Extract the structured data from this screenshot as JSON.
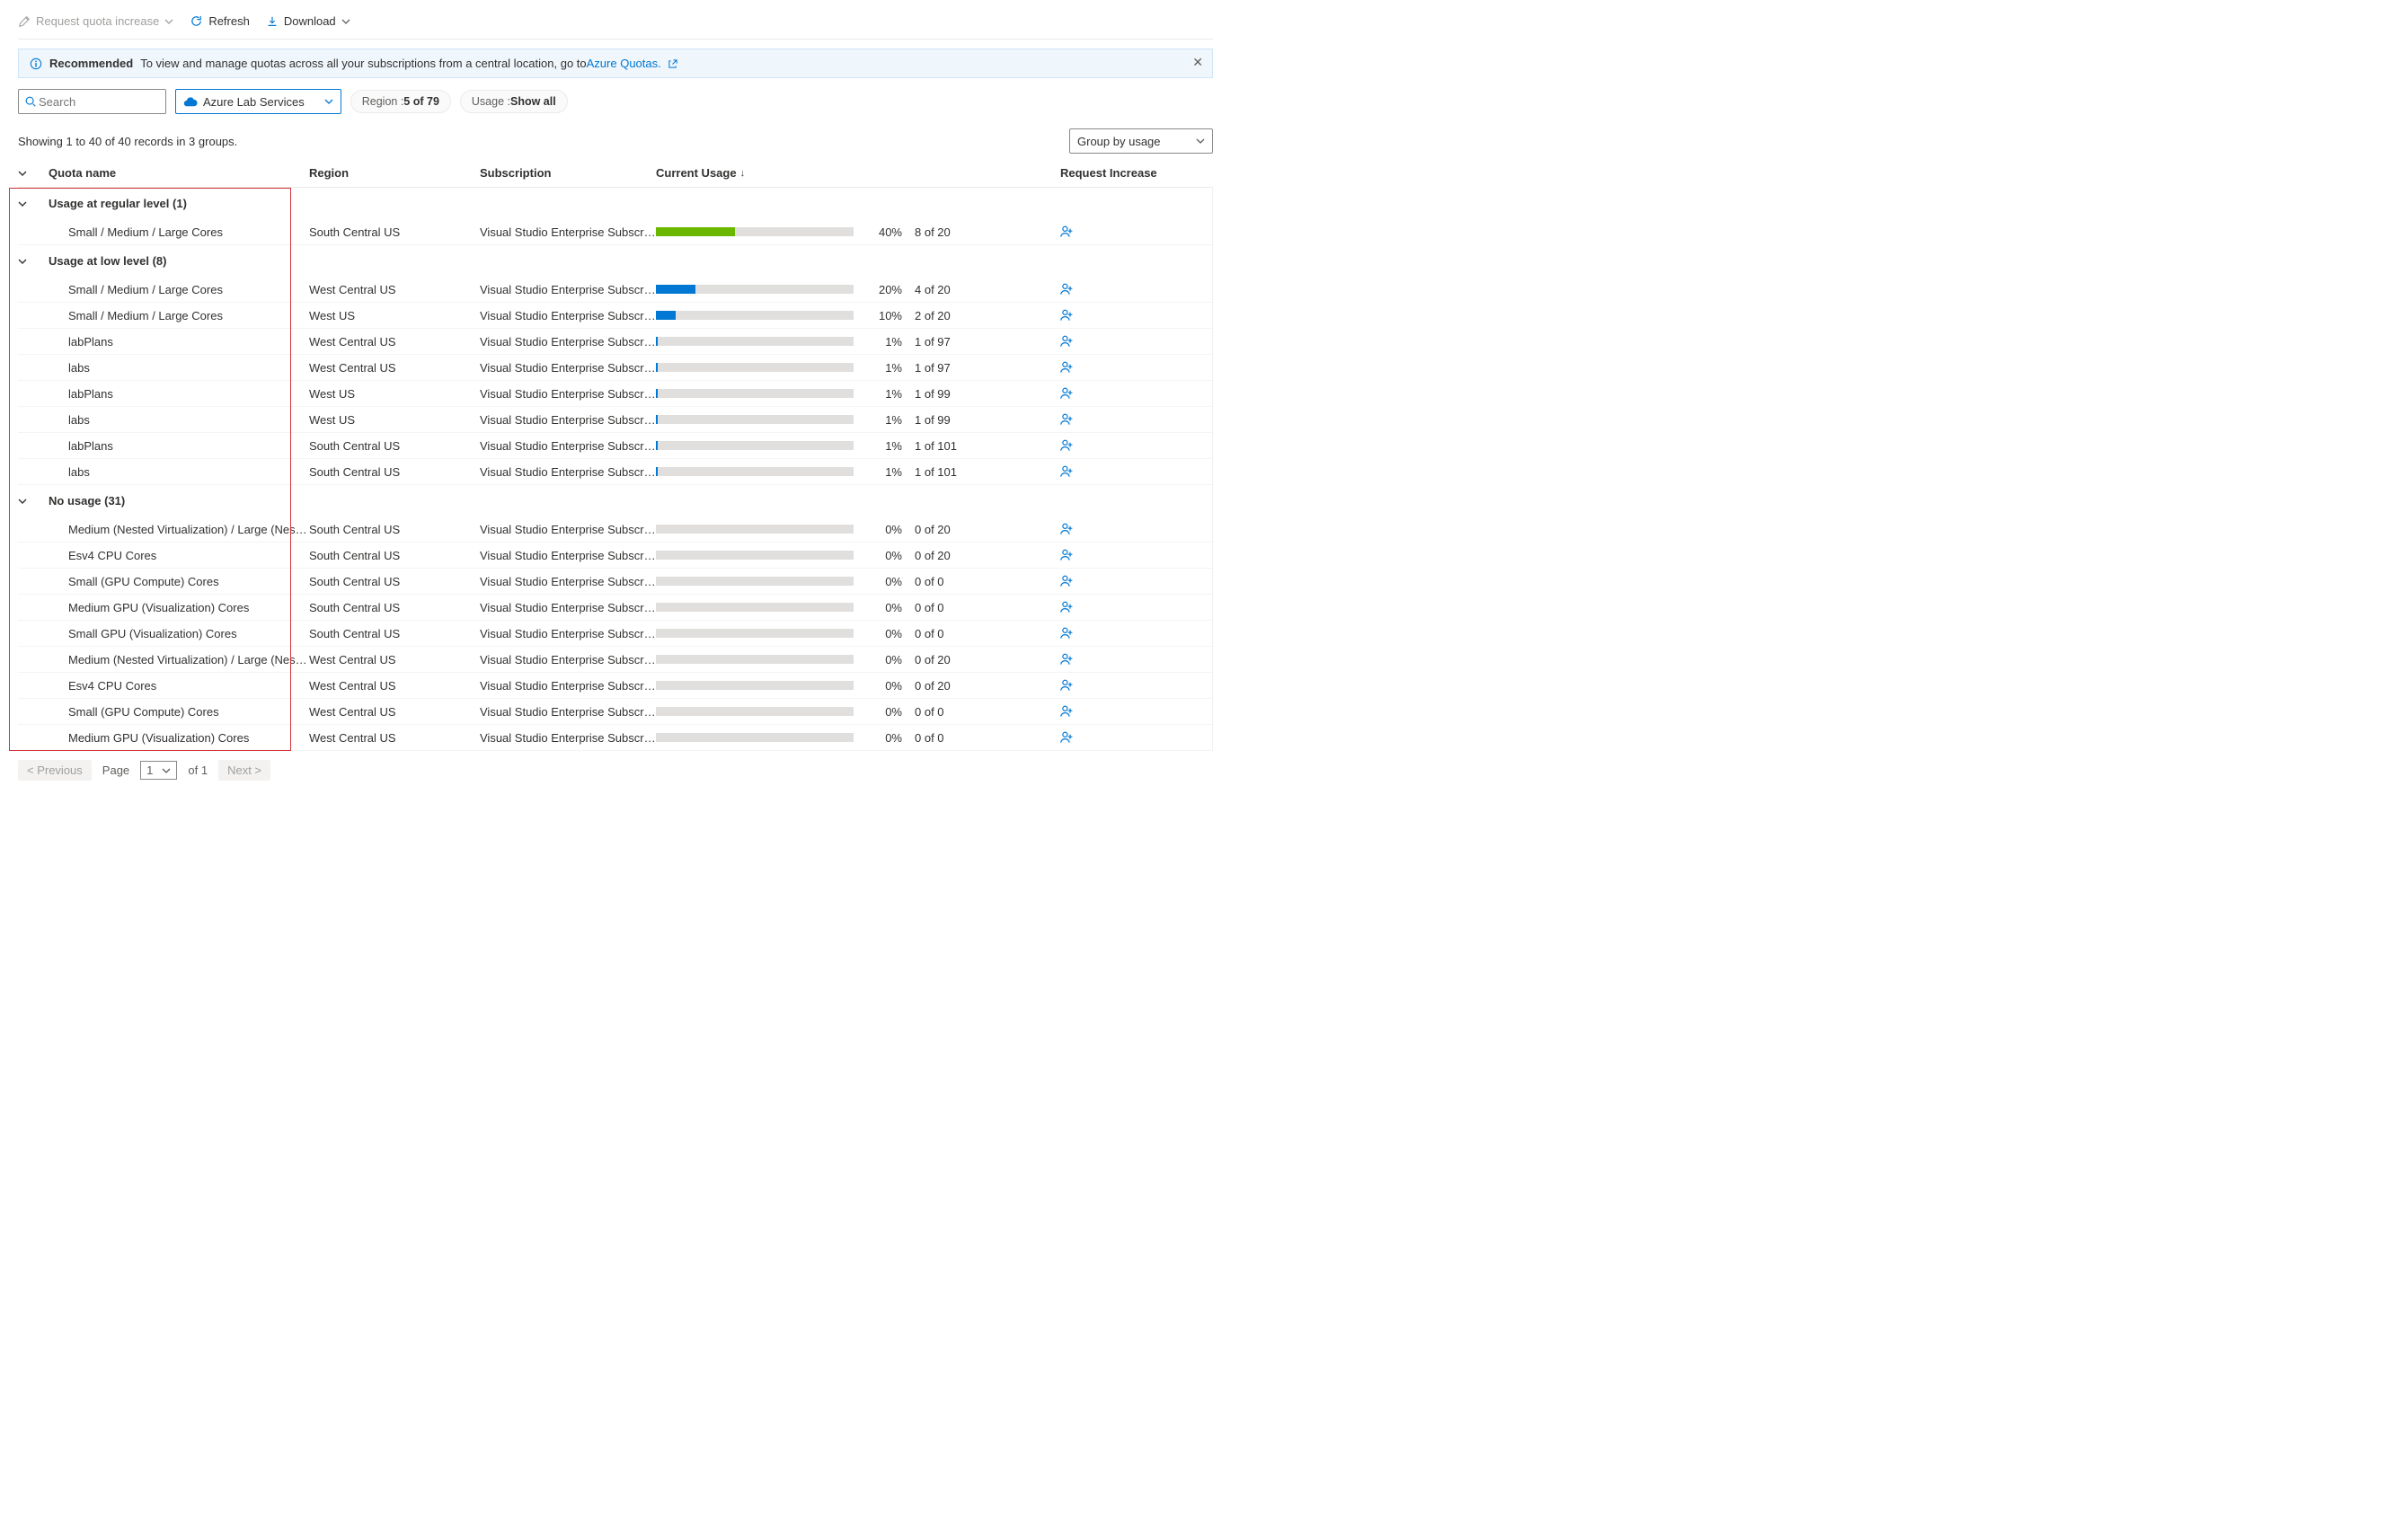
{
  "toolbar": {
    "request_increase": "Request quota increase",
    "refresh": "Refresh",
    "download": "Download"
  },
  "info": {
    "title": "Recommended",
    "text": "To view and manage quotas across all your subscriptions from a central location, go to ",
    "link": "Azure Quotas."
  },
  "filters": {
    "search_placeholder": "Search",
    "provider": "Azure Lab Services",
    "region_label": "Region : ",
    "region_value": "5 of 79",
    "usage_label": "Usage : ",
    "usage_value": "Show all"
  },
  "records_text": "Showing 1 to 40 of 40 records in 3 groups.",
  "groupby": "Group by usage",
  "columns": {
    "quota": "Quota name",
    "region": "Region",
    "subscription": "Subscription",
    "usage": "Current Usage",
    "request": "Request Increase"
  },
  "groups": [
    {
      "title": "Usage at regular level (1)",
      "rows": [
        {
          "quota": "Small / Medium / Large Cores",
          "region": "South Central US",
          "sub": "Visual Studio Enterprise Subscri...",
          "pct": 40,
          "of": "8 of 20",
          "color": "green"
        }
      ]
    },
    {
      "title": "Usage at low level (8)",
      "rows": [
        {
          "quota": "Small / Medium / Large Cores",
          "region": "West Central US",
          "sub": "Visual Studio Enterprise Subscri...",
          "pct": 20,
          "of": "4 of 20",
          "color": "blue"
        },
        {
          "quota": "Small / Medium / Large Cores",
          "region": "West US",
          "sub": "Visual Studio Enterprise Subscri...",
          "pct": 10,
          "of": "2 of 20",
          "color": "blue"
        },
        {
          "quota": "labPlans",
          "region": "West Central US",
          "sub": "Visual Studio Enterprise Subscri...",
          "pct": 1,
          "of": "1 of 97",
          "color": "blue"
        },
        {
          "quota": "labs",
          "region": "West Central US",
          "sub": "Visual Studio Enterprise Subscri...",
          "pct": 1,
          "of": "1 of 97",
          "color": "blue"
        },
        {
          "quota": "labPlans",
          "region": "West US",
          "sub": "Visual Studio Enterprise Subscri...",
          "pct": 1,
          "of": "1 of 99",
          "color": "blue"
        },
        {
          "quota": "labs",
          "region": "West US",
          "sub": "Visual Studio Enterprise Subscri...",
          "pct": 1,
          "of": "1 of 99",
          "color": "blue"
        },
        {
          "quota": "labPlans",
          "region": "South Central US",
          "sub": "Visual Studio Enterprise Subscri...",
          "pct": 1,
          "of": "1 of 101",
          "color": "blue"
        },
        {
          "quota": "labs",
          "region": "South Central US",
          "sub": "Visual Studio Enterprise Subscri...",
          "pct": 1,
          "of": "1 of 101",
          "color": "blue"
        }
      ]
    },
    {
      "title": "No usage (31)",
      "rows": [
        {
          "quota": "Medium (Nested Virtualization) / Large (Nested ...",
          "region": "South Central US",
          "sub": "Visual Studio Enterprise Subscri...",
          "pct": 0,
          "of": "0 of 20",
          "color": "blue"
        },
        {
          "quota": "Esv4 CPU Cores",
          "region": "South Central US",
          "sub": "Visual Studio Enterprise Subscri...",
          "pct": 0,
          "of": "0 of 20",
          "color": "blue"
        },
        {
          "quota": "Small (GPU Compute) Cores",
          "region": "South Central US",
          "sub": "Visual Studio Enterprise Subscri...",
          "pct": 0,
          "of": "0 of 0",
          "color": "blue"
        },
        {
          "quota": "Medium GPU (Visualization) Cores",
          "region": "South Central US",
          "sub": "Visual Studio Enterprise Subscri...",
          "pct": 0,
          "of": "0 of 0",
          "color": "blue"
        },
        {
          "quota": "Small GPU (Visualization) Cores",
          "region": "South Central US",
          "sub": "Visual Studio Enterprise Subscri...",
          "pct": 0,
          "of": "0 of 0",
          "color": "blue"
        },
        {
          "quota": "Medium (Nested Virtualization) / Large (Nested ...",
          "region": "West Central US",
          "sub": "Visual Studio Enterprise Subscri...",
          "pct": 0,
          "of": "0 of 20",
          "color": "blue"
        },
        {
          "quota": "Esv4 CPU Cores",
          "region": "West Central US",
          "sub": "Visual Studio Enterprise Subscri...",
          "pct": 0,
          "of": "0 of 20",
          "color": "blue"
        },
        {
          "quota": "Small (GPU Compute) Cores",
          "region": "West Central US",
          "sub": "Visual Studio Enterprise Subscri...",
          "pct": 0,
          "of": "0 of 0",
          "color": "blue"
        },
        {
          "quota": "Medium GPU (Visualization) Cores",
          "region": "West Central US",
          "sub": "Visual Studio Enterprise Subscri...",
          "pct": 0,
          "of": "0 of 0",
          "color": "blue"
        }
      ]
    }
  ],
  "pager": {
    "prev": "< Previous",
    "page_label": "Page",
    "page_value": "1",
    "of": "of 1",
    "next": "Next >"
  }
}
